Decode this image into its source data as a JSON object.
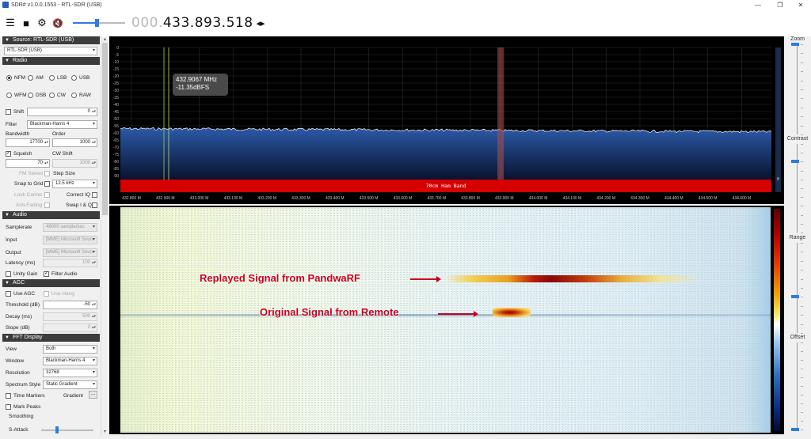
{
  "window": {
    "title": "SDR# v1.0.0.1553 - RTL-SDR (USB)",
    "minimize": "—",
    "maximize": "❐",
    "close": "✕"
  },
  "toolbar": {
    "freq_lead": "000.",
    "freq_main": "433.893.518",
    "tune_arrows": "◂▸",
    "volume_level": 0.45
  },
  "sidebar": {
    "source_header": "Source: RTL-SDR (USB)",
    "source_device": "RTL-SDR (USB)",
    "radio_header": "Radio",
    "modes_row1": [
      "NFM",
      "AM",
      "LSB",
      "USB"
    ],
    "modes_row2": [
      "WFM",
      "DSB",
      "CW",
      "RAW"
    ],
    "selected_mode": "NFM",
    "shift_label": "Shift",
    "shift_value": "0",
    "filter_label": "Filter",
    "filter_value": "Blackman-Harris 4",
    "bandwidth_label": "Bandwidth",
    "order_label": "Order",
    "bandwidth_value": "17700",
    "order_value": "1000",
    "squelch_label": "Squelch",
    "cw_shift_label": "CW Shift",
    "squelch_value": "70",
    "cw_shift_value": "1000",
    "fm_stereo_label": "FM Stereo",
    "step_size_label": "Step Size",
    "snap_to_grid_label": "Snap to Grid",
    "step_size_value": "12.5 kHz",
    "lock_carrier_label": "Lock Carrier",
    "correct_iq_label": "Correct IQ",
    "anti_fading_label": "Anti-Fading",
    "swap_iq_label": "Swap I & Q",
    "audio_header": "Audio",
    "samplerate_label": "Samplerate",
    "samplerate_value": "48000 sample/sec",
    "input_label": "Input",
    "input_value": "[MME] Microsoft Soun",
    "output_label": "Output",
    "output_value": "[MME] Microsoft Soun",
    "latency_label": "Latency (ms)",
    "latency_value": "100",
    "unity_gain_label": "Unity Gain",
    "filter_audio_label": "Filter Audio",
    "agc_header": "AGC",
    "use_agc_label": "Use AGC",
    "use_hang_label": "Use Hang",
    "threshold_label": "Threshold (dB)",
    "threshold_value": "-50",
    "decay_label": "Decay (ms)",
    "decay_value": "500",
    "slope_label": "Slope (dB)",
    "slope_value": "0",
    "fft_header": "FFT Display",
    "view_label": "View",
    "view_value": "Both",
    "window_label": "Window",
    "window_value": "Blackman-Harris 4",
    "resolution_label": "Resolution",
    "resolution_value": "32768",
    "spectrum_style_label": "Spectrum Style",
    "spectrum_style_value": "Static Gradient",
    "time_markers_label": "Time Markers",
    "gradient_label": "Gradient",
    "gradient_button": "...",
    "mark_peaks_label": "Mark Peaks",
    "smoothing_label": "Smoothing",
    "s_attack_label": "S-Attack"
  },
  "spectrum": {
    "y_ticks": [
      "0",
      "-5",
      "-10",
      "-15",
      "-20",
      "-25",
      "-30",
      "-35",
      "-40",
      "-45",
      "-50",
      "-55",
      "-60",
      "-65",
      "-70",
      "-75",
      "-80",
      "-85",
      "-90"
    ],
    "x_ticks": [
      "432.800 M",
      "432.900 M",
      "433.000 M",
      "433.100 M",
      "433.200 M",
      "433.300 M",
      "433.400 M",
      "433.500 M",
      "433.600 M",
      "433.700 M",
      "433.800 M",
      "433.900 M",
      "434.000 M",
      "434.100 M",
      "434.200 M",
      "434.300 M",
      "434.400 M",
      "434.500 M",
      "434.600 M"
    ],
    "band_label": "70cm Ham Band",
    "tooltip_freq": "432.9067 MHz",
    "tooltip_level": "-11.35dBFS",
    "noise_floor_db": -57,
    "scale_side_label": "8"
  },
  "waterfall": {
    "replayed_label": "Replayed Signal from PandwaRF",
    "original_label": "Original Signal from Remote"
  },
  "right_panel": {
    "zoom_label": "Zoom",
    "contrast_label": "Contrast",
    "range_label": "Range",
    "offset_label": "Offset",
    "zoom_level": 0.0,
    "contrast_level": 0.2,
    "range_level": 0.6,
    "offset_level": 1.0
  },
  "colors": {
    "band_bar": "#d60000",
    "spectrum_fill": "#1a3a7a",
    "annotation_red": "#c8001a",
    "accent": "#2a7de1"
  }
}
